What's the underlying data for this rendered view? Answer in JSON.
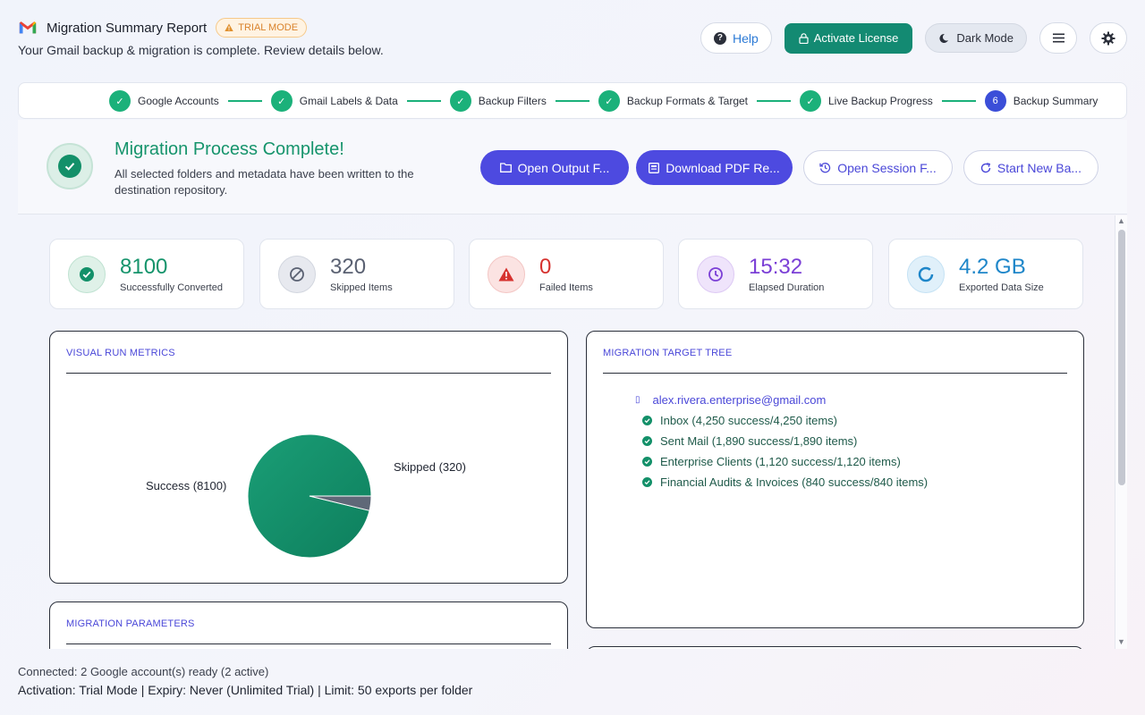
{
  "header": {
    "title": "Migration Summary Report",
    "trial_badge": "TRIAL MODE",
    "subtitle": "Your Gmail backup & migration is complete. Review details below.",
    "help_label": "Help",
    "activate_label": "Activate License",
    "dark_mode_label": "Dark Mode"
  },
  "stepper": {
    "steps": [
      {
        "label": "Google Accounts",
        "state": "done"
      },
      {
        "label": "Gmail Labels & Data",
        "state": "done"
      },
      {
        "label": "Backup Filters",
        "state": "done"
      },
      {
        "label": "Backup Formats & Target",
        "state": "done"
      },
      {
        "label": "Live Backup Progress",
        "state": "done"
      },
      {
        "label": "Backup Summary",
        "state": "current",
        "number": "6"
      }
    ]
  },
  "banner": {
    "title": "Migration Process Complete!",
    "description": "All selected folders and metadata have been written to the destination repository.",
    "buttons": {
      "open_output": "Open Output F...",
      "download_pdf": "Download PDF Re...",
      "open_session": "Open Session F...",
      "start_new": "Start New Ba..."
    }
  },
  "stats": [
    {
      "value": "8100",
      "label": "Successfully Converted",
      "color": "#16946c",
      "icon": "check-circle-icon"
    },
    {
      "value": "320",
      "label": "Skipped Items",
      "color": "#5a6172",
      "icon": "ban-icon"
    },
    {
      "value": "0",
      "label": "Failed Items",
      "color": "#d6322f",
      "icon": "warning-icon"
    },
    {
      "value": "15:32",
      "label": "Elapsed Duration",
      "color": "#7b3fd6",
      "icon": "clock-icon"
    },
    {
      "value": "4.2 GB",
      "label": "Exported Data Size",
      "color": "#1e86c9",
      "icon": "disk-ring-icon"
    }
  ],
  "metrics_panel": {
    "title": "VISUAL RUN METRICS"
  },
  "chart_data": {
    "type": "pie",
    "categories": [
      "Success",
      "Skipped"
    ],
    "values": [
      8100,
      320
    ],
    "labels": [
      "Success (8100)",
      "Skipped (320)"
    ],
    "colors": [
      "#139069",
      "#5f6878"
    ]
  },
  "tree_panel": {
    "title": "MIGRATION TARGET TREE",
    "root": "alex.rivera.enterprise@gmail.com",
    "items": [
      "Inbox (4,250 success/4,250 items)",
      "Sent Mail (1,890 success/1,890 items)",
      "Enterprise Clients (1,120 success/1,120 items)",
      "Financial Audits & Invoices (840 success/840 items)"
    ]
  },
  "params_panel": {
    "title": "MIGRATION PARAMETERS"
  },
  "footer": {
    "connected": "Connected: 2 Google account(s) ready (2 active)",
    "activation": "Activation: Trial Mode | Expiry: Never (Unlimited Trial) | Limit: 50 exports per folder"
  }
}
